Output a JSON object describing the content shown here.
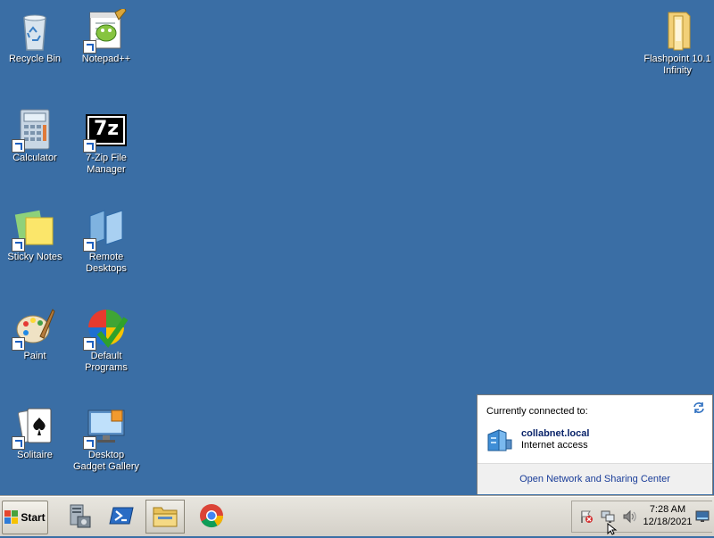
{
  "desktop": {
    "icons": [
      {
        "label": "Recycle Bin",
        "icon": "recycle-bin-icon"
      },
      {
        "label": "Notepad++",
        "icon": "notepad-plus-plus-icon"
      },
      {
        "label": "Flashpoint 10.1 Infinity",
        "icon": "folder-icon"
      },
      {
        "label": "Calculator",
        "icon": "calculator-icon"
      },
      {
        "label": "7-Zip File Manager",
        "icon": "seven-zip-icon",
        "glyph_text": "7z"
      },
      {
        "label": "Sticky Notes",
        "icon": "sticky-notes-icon"
      },
      {
        "label": "Remote Desktops",
        "icon": "remote-desktops-icon"
      },
      {
        "label": "Paint",
        "icon": "paint-icon"
      },
      {
        "label": "Default Programs",
        "icon": "default-programs-icon"
      },
      {
        "label": "Solitaire",
        "icon": "solitaire-icon"
      },
      {
        "label": "Desktop Gadget Gallery",
        "icon": "gadget-gallery-icon"
      }
    ]
  },
  "taskbar": {
    "start_label": "Start",
    "pinned": [
      {
        "icon": "server-manager-icon"
      },
      {
        "icon": "powershell-icon"
      },
      {
        "icon": "explorer-folder-icon"
      },
      {
        "icon": "chrome-icon"
      }
    ],
    "tray_icons": [
      "action-center-flag-icon",
      "network-icon",
      "volume-icon"
    ],
    "clock_time": "7:28 AM",
    "clock_date": "12/18/2021",
    "show_desktop_icon": "show-desktop-icon"
  },
  "network_popup": {
    "heading": "Currently connected to:",
    "network_name": "collabnet.local",
    "status": "Internet access",
    "link": "Open Network and Sharing Center"
  },
  "colors": {
    "desktop_bg": "#3a6ea5",
    "taskbar_bg": "#d4d0c8",
    "link": "#1a3d99"
  }
}
